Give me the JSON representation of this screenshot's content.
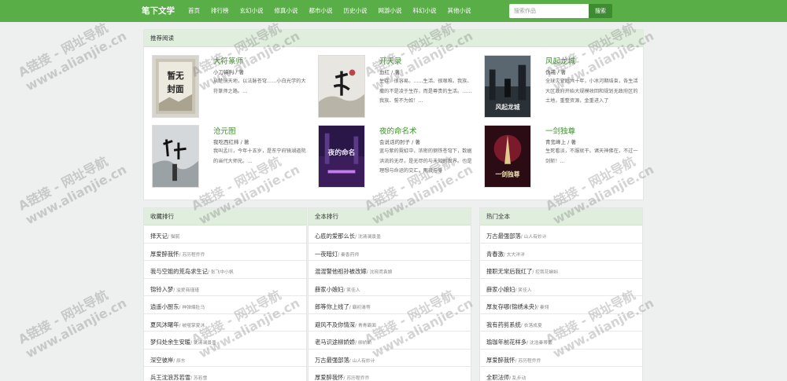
{
  "header": {
    "brand": "笔下文学",
    "nav": [
      "首页",
      "排行榜",
      "玄幻小说",
      "修真小说",
      "都市小说",
      "历史小说",
      "网游小说",
      "科幻小说",
      "其他小说"
    ],
    "search_placeholder": "搜索作品",
    "search_button": "搜索"
  },
  "recommend": {
    "title": "推荐阅读",
    "books": [
      {
        "title": "大符篆师",
        "author": "小刀锋利 / 著",
        "intro": "从楚镜天地，以法脉苍穹……小白光学的大符篆师之路。…"
      },
      {
        "title": "开天录",
        "author": "血红 / 著",
        "intro": "生存、很容易。……生活、很艰难。我族、撒的不是凌于生存，而是尊贵的生活。……我族、誓不为奴！…"
      },
      {
        "title": "风起龙城",
        "author": "伪戒 / 著",
        "intro": "全球灾变后六十年，小冰河期结束，各生活大区政府开始大规模收回和规划无政府区的土地，重整资源，金重进入了"
      },
      {
        "title": "沧元图",
        "author": "我吃西红柿 / 著",
        "intro": "我叫孟川，今年十五岁，是东宁府镜湖道院的当代大师兄。…"
      },
      {
        "title": "夜的命名术",
        "author": "会说话的肘子 / 著",
        "intro": "蓝与紫的霓虹中，浓密的钢铁苍穹下，数据洪流的无尽，是无尽的与未知的世界。也是理想与命运的交汇，雨夜与身"
      },
      {
        "title": "一剑独尊",
        "author": "青鸾峰上 / 著",
        "intro": "生死看淡，不服就干。诸天神佛在，不过一剑斩！…"
      }
    ]
  },
  "lists": [
    {
      "title": "收藏排行",
      "items": [
        {
          "title": "择天记",
          "author": "猫腻"
        },
        {
          "title": "厚爱醉我怀",
          "author": "苏历程乔乔"
        },
        {
          "title": "我与空姐的荒岛求生记",
          "author": "张飞中小帆"
        },
        {
          "title": "锦铃入梦",
          "author": "溢爱商瑾瑾"
        },
        {
          "title": "逍遥小厨东",
          "author": "神弹爆肚马"
        },
        {
          "title": "夏风沐曙年",
          "author": "被噬掌夏沐"
        },
        {
          "title": "梦归处余生安暖",
          "author": "沈清澜景墨"
        },
        {
          "title": "深空彼岸",
          "author": "辰东"
        },
        {
          "title": "兵王沈浪苏若雪",
          "author": "苏若雪"
        }
      ]
    },
    {
      "title": "全本排行",
      "items": [
        {
          "title": "心底的爱那么长",
          "author": "沈清澜景墨"
        },
        {
          "title": "一夜暗灯",
          "author": "秦香药师"
        },
        {
          "title": "混混警他祖孙被改嫁",
          "author": "沈琬鸢袁娘"
        },
        {
          "title": "薛家小娘妇",
          "author": "笑佳人"
        },
        {
          "title": "郎等你上线了",
          "author": "霸初清等"
        },
        {
          "title": "避风不及你情深",
          "author": "青青霸面"
        },
        {
          "title": "老马识途柳娇娇",
          "author": "柳娇娇"
        },
        {
          "title": "万古最强部落",
          "author": "山人有妙计"
        },
        {
          "title": "厚爱醉我怀",
          "author": "苏历程乔乔"
        }
      ]
    },
    {
      "title": "热门全本",
      "items": [
        {
          "title": "万古最强部落",
          "author": "山人有妙计"
        },
        {
          "title": "青春激",
          "author": "大大洋洋"
        },
        {
          "title": "撞职无常后我红了",
          "author": "控我花蝌蚪"
        },
        {
          "title": "薛家小娘妇",
          "author": "笑佳人"
        },
        {
          "title": "厚友存哪(锦绣未央)",
          "author": "秦翎"
        },
        {
          "title": "我有药剪系统",
          "author": "衣落成夏"
        },
        {
          "title": "瑜珈年前花样多",
          "author": "沈浩秦蒂蕾"
        },
        {
          "title": "厚爱醉我怀",
          "author": "苏历程乔乔"
        },
        {
          "title": "全职法师",
          "author": "乱步动"
        }
      ]
    }
  ],
  "watermark": "A链接 - 网址导航\nwww.alianjie.cn"
}
